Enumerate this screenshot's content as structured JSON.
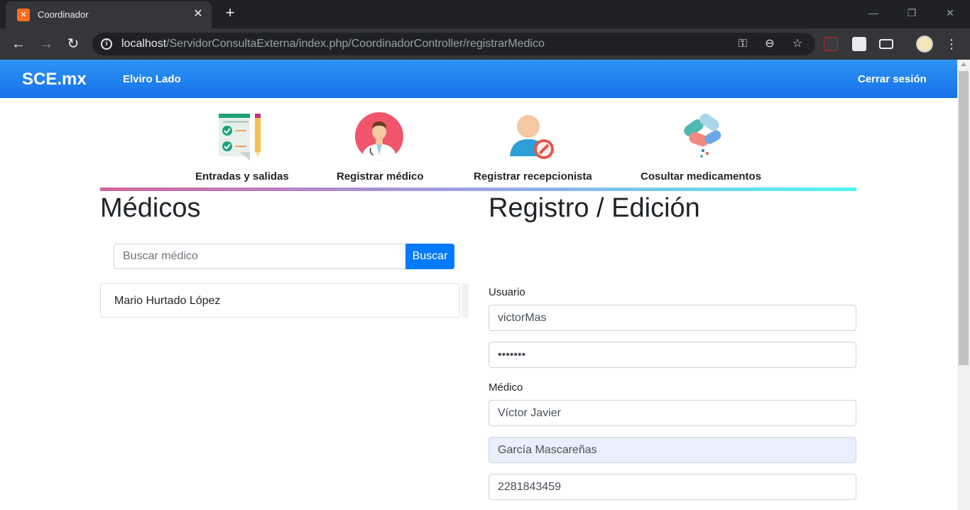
{
  "browser": {
    "tab_title": "Coordinador",
    "url_host": "localhost",
    "url_path": "/ServidorConsultaExterna/index.php/CoordinadorController/registrarMedico"
  },
  "navbar": {
    "brand": "SCE.mx",
    "user": "Elviro Lado",
    "logout": "Cerrar sesión"
  },
  "menu": {
    "items": [
      {
        "label": "Entradas y salidas",
        "icon": "checklist-icon"
      },
      {
        "label": "Registrar médico",
        "icon": "doctor-icon"
      },
      {
        "label": "Registrar recepcionista",
        "icon": "receptionist-icon"
      },
      {
        "label": "Cosultar medicamentos",
        "icon": "pills-icon"
      }
    ]
  },
  "medicos": {
    "title": "Médicos",
    "search_placeholder": "Buscar médico",
    "search_button": "Buscar",
    "list": [
      "Mario Hurtado López"
    ]
  },
  "registro": {
    "title": "Registro / Edición",
    "usuario_label": "Usuario",
    "usuario_value": "victorMas",
    "password_value": "•••••••",
    "medico_label": "Médico",
    "nombre_value": "Víctor Javier",
    "apellidos_value": "García Mascareñas",
    "telefono_value": "2281843459"
  },
  "colors": {
    "navbar": "#1770e8",
    "button": "#007bff"
  }
}
